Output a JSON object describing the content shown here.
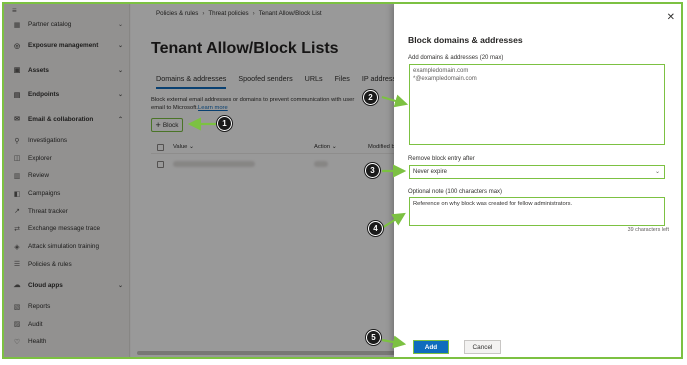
{
  "nav": {
    "items": [
      {
        "label": "Partner catalog",
        "icon": "catalog-icon",
        "group": false,
        "chev": "down"
      },
      {
        "label": "Exposure management",
        "icon": "exposure-icon",
        "group": true,
        "chev": "down"
      },
      {
        "label": "Assets",
        "icon": "assets-icon",
        "group": true,
        "chev": "down"
      },
      {
        "label": "Endpoints",
        "icon": "endpoints-icon",
        "group": true,
        "chev": "down"
      },
      {
        "label": "Email & collaboration",
        "icon": "email-icon",
        "group": true,
        "chev": "up"
      },
      {
        "label": "Investigations",
        "icon": "investigations-icon",
        "group": false
      },
      {
        "label": "Explorer",
        "icon": "explorer-icon",
        "group": false
      },
      {
        "label": "Review",
        "icon": "review-icon",
        "group": false
      },
      {
        "label": "Campaigns",
        "icon": "campaigns-icon",
        "group": false
      },
      {
        "label": "Threat tracker",
        "icon": "tracker-icon",
        "group": false
      },
      {
        "label": "Exchange message trace",
        "icon": "trace-icon",
        "group": false
      },
      {
        "label": "Attack simulation training",
        "icon": "simulation-icon",
        "group": false
      },
      {
        "label": "Policies & rules",
        "icon": "policies-icon",
        "group": false
      },
      {
        "label": "Cloud apps",
        "icon": "cloud-icon",
        "group": true,
        "chev": "down"
      },
      {
        "label": "Reports",
        "icon": "reports-icon",
        "group": false
      },
      {
        "label": "Audit",
        "icon": "audit-icon",
        "group": false
      },
      {
        "label": "Health",
        "icon": "health-icon",
        "group": false
      }
    ]
  },
  "breadcrumb": [
    "Policies & rules",
    "Threat policies",
    "Tenant Allow/Block List"
  ],
  "page": {
    "title": "Tenant Allow/Block Lists",
    "tabs": [
      "Domains & addresses",
      "Spoofed senders",
      "URLs",
      "Files",
      "IP addresses"
    ],
    "description": "Block external email addresses or domains to prevent communication with user",
    "description_tail": "email to Microsoft.",
    "learn_more": "Learn more",
    "block_button": "Block",
    "columns": {
      "value": "Value",
      "action": "Action",
      "modified": "Modified by"
    }
  },
  "panel": {
    "title": "Block domains & addresses",
    "domains_label": "Add domains & addresses (20 max)",
    "domains_value": [
      "exampledomain.com",
      "*@exampledomain.com"
    ],
    "expire_label": "Remove block entry after",
    "expire_value": "Never expire",
    "note_label": "Optional note (100 characters max)",
    "note_value": "Reference on why block was created for fellow administrators.",
    "counter": "39 characters left",
    "add_button": "Add",
    "cancel_button": "Cancel"
  },
  "callouts": [
    "1",
    "2",
    "3",
    "4",
    "5"
  ],
  "colors": {
    "accent": "#0f6cbd",
    "highlight": "#7cc142",
    "callout": "#1b1b1b"
  }
}
